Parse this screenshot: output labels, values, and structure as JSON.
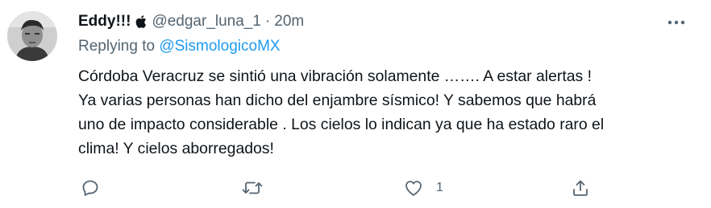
{
  "tweet": {
    "display_name": "Eddy!!!",
    "handle": "@edgar_luna_1",
    "separator": "·",
    "time": "20m",
    "reply_prefix": "Replying to",
    "reply_to": "@SismologicoMX",
    "text_lines": [
      "Córdoba Veracruz se sintió una vibración solamente ……. A estar alertas !",
      "Ya varias personas han dicho del enjambre sísmico! Y sabemos que habrá",
      "uno de impacto considerable . Los cielos lo indican ya que ha estado raro el",
      "clima! Y cielos aborregados!"
    ]
  },
  "actions": {
    "reply_icon": "reply-icon",
    "retweet_icon": "retweet-icon",
    "like_icon": "heart-icon",
    "like_count": "1",
    "share_icon": "share-icon"
  },
  "colors": {
    "text": "#0f1419",
    "secondary": "#536471",
    "link": "#1d9bf0"
  }
}
